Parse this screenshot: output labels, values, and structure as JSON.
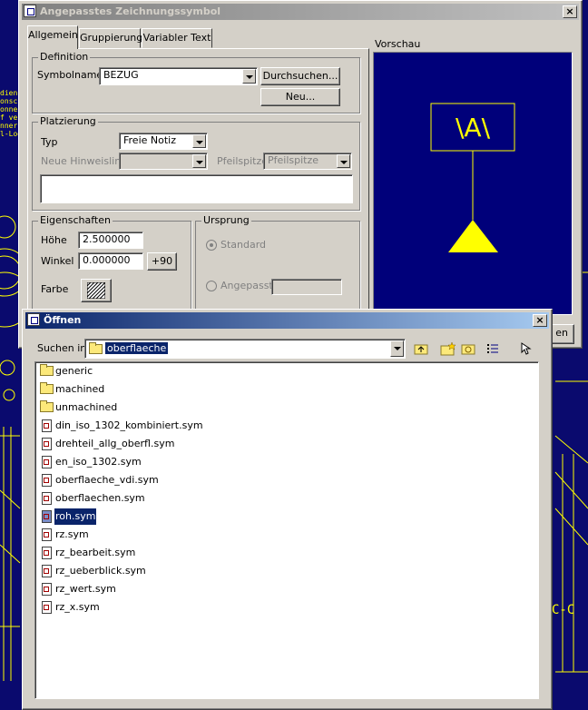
{
  "background": {
    "cad_left_text": [
      "dien",
      "onsch",
      "onne",
      "f ve",
      "nner",
      "l-Log"
    ],
    "cad_right_text": "C-C"
  },
  "symbol_dialog": {
    "title": "Angepasstes Zeichnungssymbol",
    "tabs": [
      {
        "label": "Allgemein",
        "active": true
      },
      {
        "label": "Gruppierung",
        "active": false
      },
      {
        "label": "Variabler Text",
        "active": false
      }
    ],
    "definition": {
      "group_label": "Definition",
      "symbol_name_label": "Symbolname",
      "symbol_name_value": "BEZUG",
      "browse_button": "Durchsuchen...",
      "new_button": "Neu..."
    },
    "placement": {
      "group_label": "Platzierung",
      "type_label": "Typ",
      "type_value": "Freie Notiz",
      "leader_label": "Neue Hinweislinie",
      "leader_value": "",
      "arrow_label": "Pfeilspitze",
      "arrow_value": "Pfeilspitze"
    },
    "properties": {
      "group_label": "Eigenschaften",
      "height_label": "Höhe",
      "height_value": "2.500000",
      "angle_label": "Winkel",
      "angle_value": "0.000000",
      "rotate_button": "+90",
      "color_label": "Farbe"
    },
    "origin": {
      "group_label": "Ursprung",
      "standard_label": "Standard",
      "custom_label": "Angepasst",
      "custom_value": ""
    },
    "preview": {
      "label": "Vorschau",
      "symbol_text": "\\A\\",
      "background_color": "#00007a",
      "symbol_color": "#ffff00"
    },
    "partial_button": "en"
  },
  "open_dialog": {
    "title": "Öffnen",
    "look_in_label": "Suchen in",
    "look_in_value": "oberflaeche",
    "files": [
      {
        "name": "generic",
        "type": "folder"
      },
      {
        "name": "machined",
        "type": "folder"
      },
      {
        "name": "unmachined",
        "type": "folder"
      },
      {
        "name": "din_iso_1302_kombiniert.sym",
        "type": "file"
      },
      {
        "name": "drehteil_allg_oberfl.sym",
        "type": "file"
      },
      {
        "name": "en_iso_1302.sym",
        "type": "file"
      },
      {
        "name": "oberflaeche_vdi.sym",
        "type": "file"
      },
      {
        "name": "oberflaechen.sym",
        "type": "file"
      },
      {
        "name": "roh.sym",
        "type": "file",
        "selected": true
      },
      {
        "name": "rz.sym",
        "type": "file"
      },
      {
        "name": "rz_bearbeit.sym",
        "type": "file"
      },
      {
        "name": "rz_ueberblick.sym",
        "type": "file"
      },
      {
        "name": "rz_wert.sym",
        "type": "file"
      },
      {
        "name": "rz_x.sym",
        "type": "file"
      }
    ],
    "toolbar_icons": [
      "up-folder-icon",
      "new-folder-icon",
      "favorites-icon",
      "view-menu-icon",
      "options-icon"
    ]
  }
}
